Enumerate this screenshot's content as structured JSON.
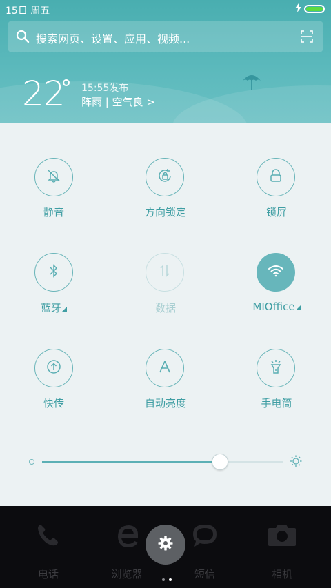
{
  "status_bar": {
    "date": "15日  周五",
    "battery_level": 1.0
  },
  "search": {
    "placeholder": "搜索网页、设置、应用、视频..."
  },
  "weather": {
    "temperature": "22",
    "degree_symbol": "°",
    "publish_time": "15:55发布",
    "condition": "阵雨 | 空气良 >"
  },
  "toggles": [
    {
      "label": "静音",
      "icon": "bell-mute-icon",
      "state": "off"
    },
    {
      "label": "方向锁定",
      "icon": "rotation-lock-icon",
      "state": "off"
    },
    {
      "label": "锁屏",
      "icon": "lock-icon",
      "state": "off"
    },
    {
      "label": "蓝牙",
      "icon": "bluetooth-icon",
      "state": "off",
      "has_more": true
    },
    {
      "label": "数据",
      "icon": "mobile-data-icon",
      "state": "disabled"
    },
    {
      "label": "MIOffice",
      "icon": "wifi-icon",
      "state": "on",
      "has_more": true
    },
    {
      "label": "快传",
      "icon": "transfer-icon",
      "state": "off"
    },
    {
      "label": "自动亮度",
      "icon": "auto-brightness-icon",
      "state": "off"
    },
    {
      "label": "手电筒",
      "icon": "flashlight-icon",
      "state": "off"
    }
  ],
  "brightness": {
    "level": 0.74
  },
  "dock": {
    "items": [
      {
        "label": "电话",
        "icon": "phone-icon"
      },
      {
        "label": "浏览器",
        "icon": "browser-icon"
      },
      {
        "label": "短信",
        "icon": "message-icon"
      },
      {
        "label": "相机",
        "icon": "camera-icon"
      }
    ],
    "settings_icon": "gear-icon",
    "pages": 2,
    "active_page": 1
  },
  "colors": {
    "accent": "#67b6bb",
    "header": "#55b5b8",
    "panel_bg": "#ecf2f3",
    "battery": "#5ddb3f"
  }
}
